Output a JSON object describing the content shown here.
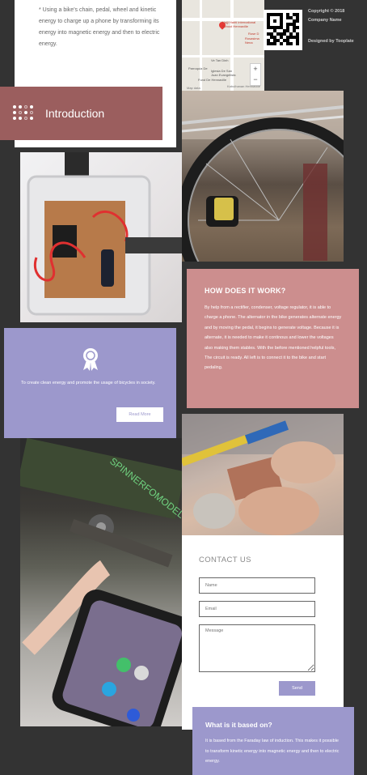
{
  "intro_text": "* Using a bike's chain, pedal, wheel and kinetic energy to charge up a phone by transforming its energy into magnetic energy and then to electric energy.",
  "map": {
    "labels": [
      "Hajji Hahti international School Hennaville",
      "Rose D",
      "Rosasima Nena",
      "Ve Tan Dinh",
      "Iglesia De San",
      "Juan Evangelista",
      "Parroquia De",
      "Fund De Hennaville",
      "Map data",
      "Kabulhanan Hennaville"
    ],
    "zoom_in": "+",
    "zoom_out": "−"
  },
  "footer": {
    "copyright": "Copyright © 2018 Company Name",
    "designed": "Designed by Tooplate"
  },
  "introduction": {
    "title": "Introduction"
  },
  "how": {
    "title": "HOW DOES IT WORK?",
    "body": "By help from a rectifier, condenser, voltage regulator, it is able to charge a phone. The alternator in the bike generates alternate energy and by moving the pedal, it begins to generate voltage. Because it is alternate, it is needed to make it continous and lower the voltages also making them stables. With the before mentioned helpful tools, The circuit is ready. All left is to connect it to the bike and start pedaling."
  },
  "purpose": {
    "text": "To create clean energy and promote the usage of bicycles in society.",
    "button": "Read More"
  },
  "contact": {
    "title": "CONTACT US",
    "name_placeholder": "Name",
    "email_placeholder": "Email",
    "message_placeholder": "Message",
    "send": "Send"
  },
  "based": {
    "title": "What is it based on?",
    "body": "It is based from the Faraday law of induction. This makes it possible to transform kinetic energy into magnetic energy and then to electric energy."
  },
  "photos": {
    "bike_label": "SPINNERFOMODEL"
  },
  "colors": {
    "intro_bar": "#9b5e5e",
    "how_card": "#cc8e8e",
    "lavender": "#9c98cc"
  }
}
